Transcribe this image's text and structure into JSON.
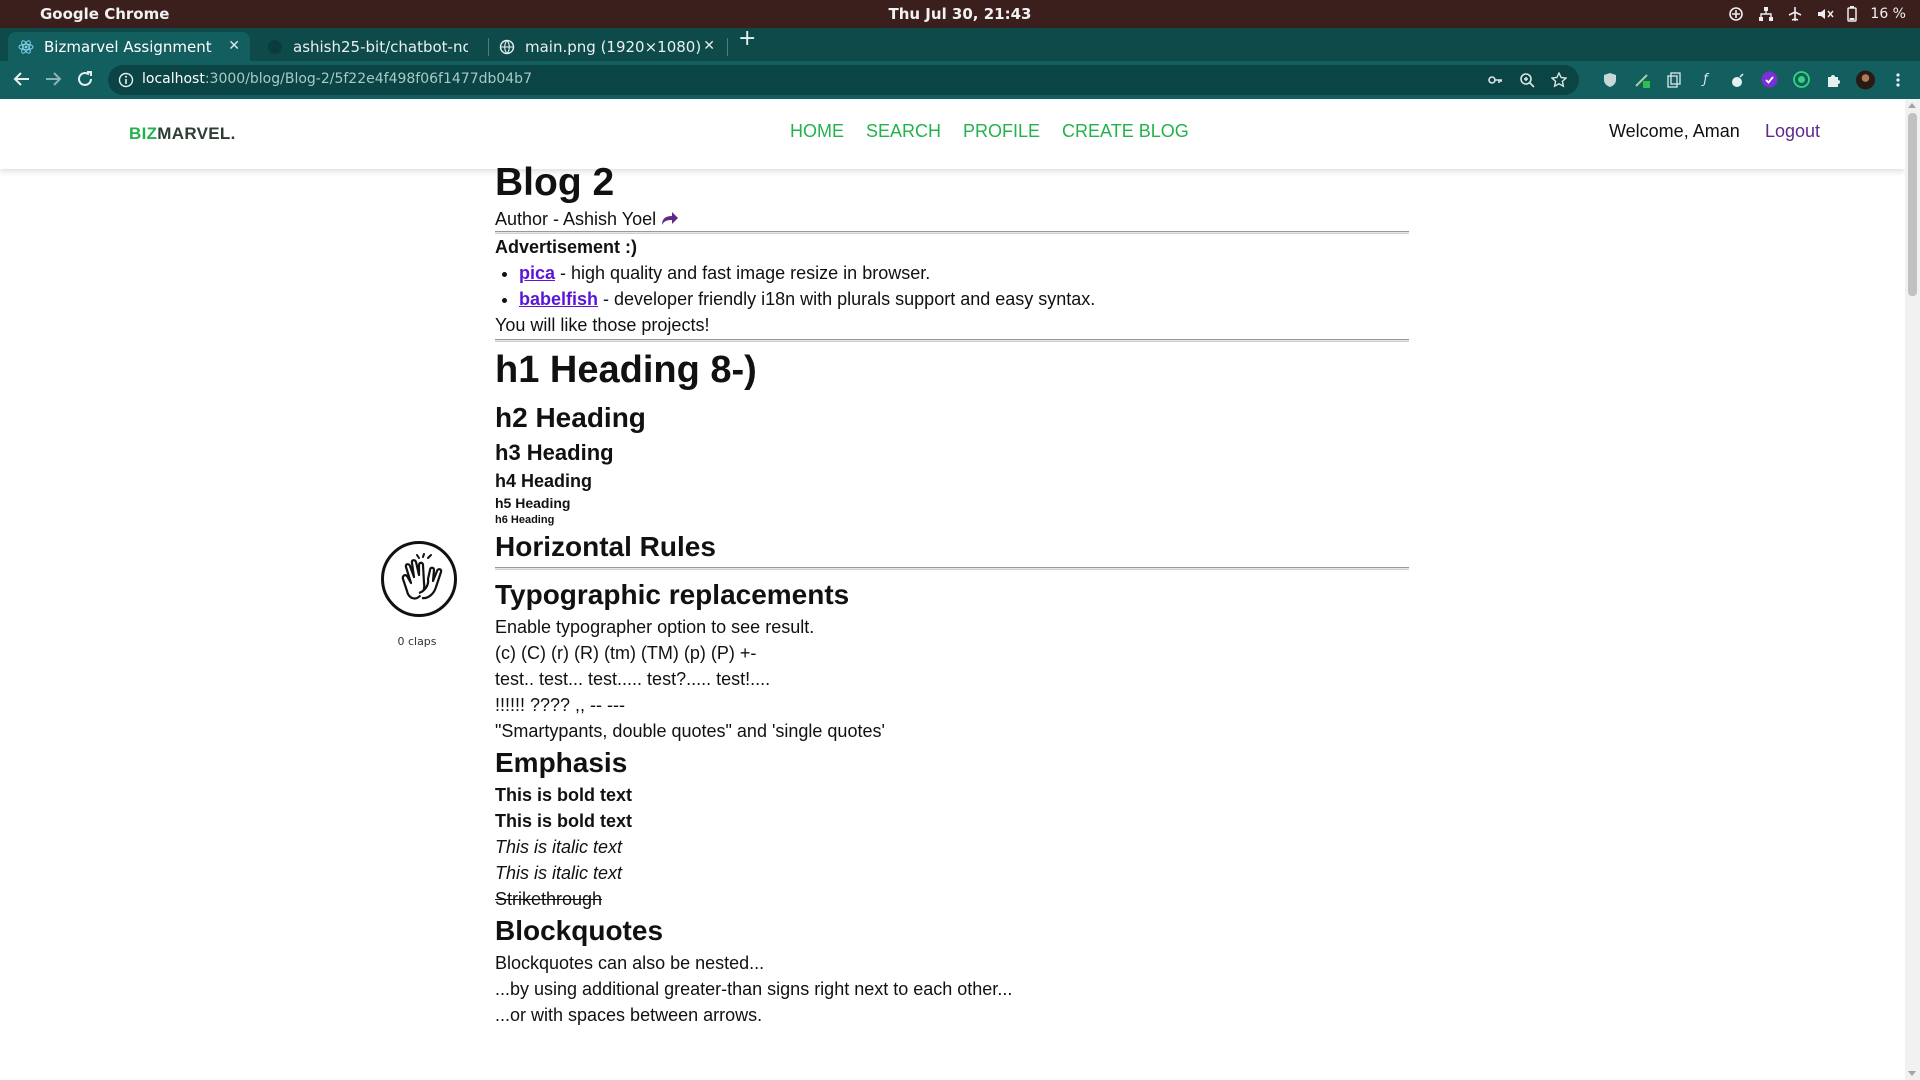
{
  "os": {
    "app_name": "Google Chrome",
    "clock": "Thu Jul 30, 21:43",
    "battery": "16 %"
  },
  "browser": {
    "tabs": [
      {
        "title": "Bizmarvel Assignment",
        "icon": "react-icon",
        "active": true
      },
      {
        "title": "ashish25-bit/chatbot-nod",
        "icon": "github-icon",
        "active": false
      },
      {
        "title": "main.png (1920×1080)",
        "icon": "globe-icon",
        "active": false
      }
    ],
    "new_tab_label": "+",
    "close_label": "✕",
    "url_host": "localhost",
    "url_rest": ":3000/blog/Blog-2/5f22e4f498f06f1477db04b7"
  },
  "header": {
    "logo_accent": "BIZ",
    "logo_rest": "MARVEL.",
    "nav": [
      "HOME",
      "SEARCH",
      "PROFILE",
      "CREATE BLOG"
    ],
    "welcome": "Welcome, Aman",
    "logout": "Logout"
  },
  "claps": {
    "count_label": "0 claps"
  },
  "article": {
    "title": "Blog 2",
    "author": "Author - Ashish Yoel",
    "ad_title": "Advertisement :)",
    "ad_items": [
      {
        "link": "pica",
        "text": " - high quality and fast image resize in browser."
      },
      {
        "link": "babelfish",
        "text": " - developer friendly i18n with plurals support and easy syntax."
      }
    ],
    "ad_footer": "You will like those projects!",
    "h1": "h1 Heading 8-)",
    "h2": "h2 Heading",
    "h3": "h3 Heading",
    "h4": "h4 Heading",
    "h5": "h5 Heading",
    "h6": "h6 Heading",
    "hr_title": "Horizontal Rules",
    "typo_title": "Typographic replacements",
    "typo_lines": [
      "Enable typographer option to see result.",
      "(c) (C) (r) (R) (tm) (TM) (p) (P) +-",
      "test.. test... test..... test?..... test!....",
      "!!!!!! ???? ,, -- ---",
      "\"Smartypants, double quotes\" and 'single quotes'"
    ],
    "emphasis_title": "Emphasis",
    "bold_1": "This is bold text",
    "bold_2": "This is bold text",
    "italic_1": "This is italic text",
    "italic_2": "This is italic text",
    "strike": "Strikethrough",
    "blockquotes_title": "Blockquotes",
    "bq_lines": [
      "Blockquotes can also be nested...",
      "...by using additional greater-than signs right next to each other...",
      "...or with spaces between arrows."
    ]
  },
  "colors": {
    "brand_green": "#23b24c",
    "logout_purple": "#5e2a8a",
    "link_purple": "#5a16d6",
    "chrome_tab_strip": "#0e4a4a",
    "chrome_toolbar": "#135f5f"
  }
}
